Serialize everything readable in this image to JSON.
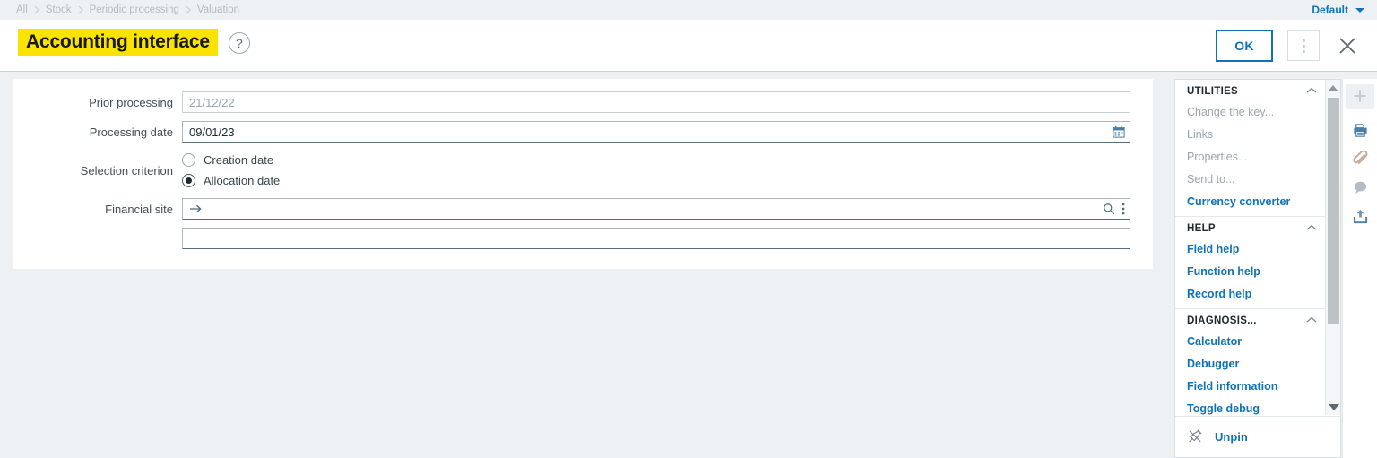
{
  "breadcrumb": {
    "items": [
      {
        "label": "All"
      },
      {
        "label": "Stock"
      },
      {
        "label": "Periodic processing"
      },
      {
        "label": "Valuation"
      }
    ]
  },
  "header": {
    "profile_label": "Default",
    "title": "Accounting interface",
    "help_icon": "question-mark-icon",
    "ok_label": "OK",
    "kebab_icon": "vertical-dots-icon",
    "close_icon": "close-icon"
  },
  "form": {
    "fields": {
      "prior_processing": {
        "label": "Prior processing",
        "value": "21/12/22"
      },
      "processing_date": {
        "label": "Processing date",
        "value": "09/01/23",
        "icon": "calendar-icon"
      },
      "selection_criterion": {
        "label": "Selection criterion",
        "options": [
          {
            "label": "Creation date",
            "selected": false
          },
          {
            "label": "Allocation date",
            "selected": true
          }
        ]
      },
      "financial_site": {
        "label": "Financial site",
        "value": "",
        "link_icon": "arrow-right-icon",
        "search_icon": "search-icon",
        "menu_icon": "vertical-dots-icon"
      },
      "extra": {
        "label": "",
        "value": ""
      }
    }
  },
  "right_panel": {
    "sections": [
      {
        "title": "UTILITIES",
        "collapse_icon": "chevron-up-icon",
        "items": [
          {
            "label": "Change the key...",
            "state": "dim"
          },
          {
            "label": "Links",
            "state": "dim"
          },
          {
            "label": "Properties...",
            "state": "dim"
          },
          {
            "label": "Send to...",
            "state": "dim"
          },
          {
            "label": "Currency converter",
            "state": "link"
          }
        ]
      },
      {
        "title": "HELP",
        "collapse_icon": "chevron-up-icon",
        "items": [
          {
            "label": "Field help",
            "state": "link"
          },
          {
            "label": "Function help",
            "state": "link"
          },
          {
            "label": "Record help",
            "state": "link"
          }
        ]
      },
      {
        "title": "DIAGNOSIS...",
        "collapse_icon": "chevron-up-icon",
        "items": [
          {
            "label": "Calculator",
            "state": "link"
          },
          {
            "label": "Debugger",
            "state": "link"
          },
          {
            "label": "Field information",
            "state": "link"
          },
          {
            "label": "Toggle debug",
            "state": "link"
          }
        ]
      }
    ],
    "footer": {
      "label": "Unpin",
      "icon": "pin-icon"
    },
    "scrollbar": {
      "up_icon": "scroll-up-arrow",
      "down_icon": "scroll-down-arrow"
    }
  },
  "rail": {
    "buttons": [
      {
        "icon": "plus-icon"
      },
      {
        "icon": "printer-icon"
      },
      {
        "icon": "paperclip-icon"
      },
      {
        "icon": "comment-icon"
      },
      {
        "icon": "upload-icon"
      }
    ]
  },
  "colors": {
    "accent_blue": "#1072b8",
    "highlight_yellow": "#fbe300",
    "page_bg": "#eef1f3",
    "muted_text": "#9aa6ae"
  }
}
